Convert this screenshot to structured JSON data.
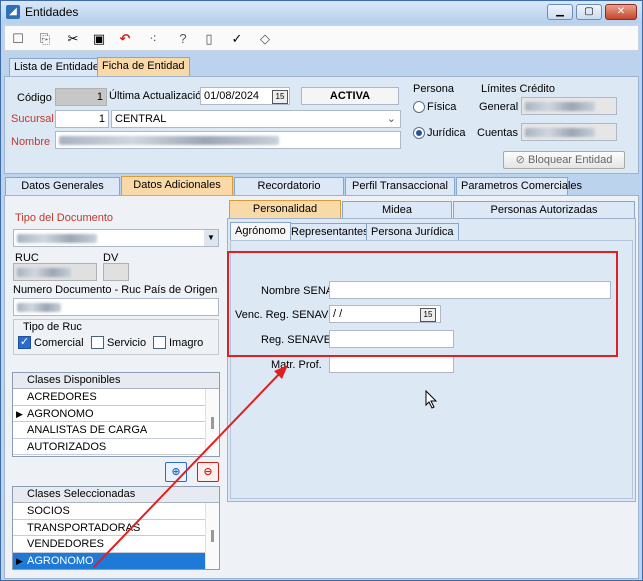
{
  "window": {
    "title": "Entidades"
  },
  "toolbar": {
    "icons": [
      "new-icon",
      "copy-icon",
      "delete-icon",
      "save-icon",
      "undo-icon",
      "dots-icon",
      "help-icon",
      "clipboard-icon",
      "check-icon",
      "eraser-icon"
    ]
  },
  "top_tabs": [
    "Lista de Entidades",
    "Ficha de Entidad"
  ],
  "header": {
    "codigo_label": "Código",
    "codigo_value": "1",
    "ultima_label": "Última Actualización",
    "ultima_value": "01/08/2024",
    "status": "ACTIVA",
    "sucursal_label": "Sucursal",
    "sucursal_num": "1",
    "sucursal_name": "CENTRAL",
    "nombre_label": "Nombre"
  },
  "persona": {
    "label": "Persona",
    "fisica": "Física",
    "juridica": "Jurídica",
    "selected": "juridica"
  },
  "limites": {
    "label": "Límites Crédito",
    "general": "General",
    "cuentas": "Cuentas"
  },
  "bloquear_label": "Bloquear Entidad",
  "main_tabs": [
    "Datos Generales",
    "Datos Adicionales",
    "Recordatorio",
    "Perfil Transaccional",
    "Parametros Comerciales"
  ],
  "left": {
    "tipo_doc_label": "Tipo del Documento",
    "ruc_label": "RUC",
    "dv_label": "DV",
    "numero_label": "Numero Documento - Ruc País de Origen",
    "tipo_ruc_label": "Tipo de Ruc",
    "comercial": "Comercial",
    "servicio": "Servicio",
    "imagro": "Imagro"
  },
  "clases_disponibles": {
    "header": "Clases Disponibles",
    "items": [
      "ACREDORES",
      "AGRONOMO",
      "ANALISTAS DE CARGA",
      "AUTORIZADOS"
    ],
    "pointer_index": 1
  },
  "clases_seleccionadas": {
    "header": "Clases Seleccionadas",
    "items": [
      "SOCIOS",
      "TRANSPORTADORAS",
      "VENDEDORES",
      "AGRONOMO"
    ],
    "selected_index": 3
  },
  "right_tabs": [
    "Personalidad",
    "Midea",
    "Personas Autorizadas"
  ],
  "sub_tabs": [
    "Agrónomo",
    "Representantes",
    "Persona Jurídica"
  ],
  "agronomo": {
    "nombre_label": "Nombre SENAVE",
    "venc_label": "Venc. Reg. SENAVE",
    "venc_value": " /  /",
    "reg_label": "Reg. SENAVE",
    "matr_label": "Matr. Prof."
  },
  "colors": {
    "highlight_box": "#e02020",
    "arrow": "#e02020",
    "selection": "#1e7ad6",
    "orange_tab": "#f9d9a8"
  }
}
